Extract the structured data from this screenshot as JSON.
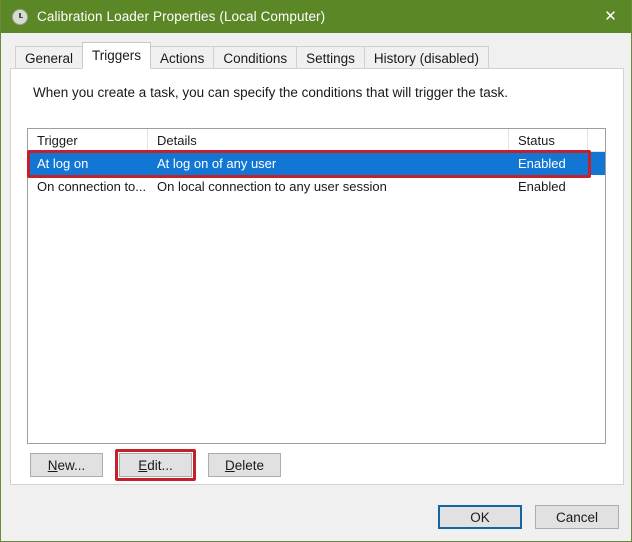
{
  "window": {
    "title": "Calibration Loader Properties (Local Computer)",
    "icon": "clock-icon",
    "close_label": "✕",
    "titlebar_color": "#5c8727",
    "accent_color": "#1277d4",
    "annotation_color": "#c4202a"
  },
  "tabs": [
    {
      "label": "General",
      "active": false
    },
    {
      "label": "Triggers",
      "active": true
    },
    {
      "label": "Actions",
      "active": false
    },
    {
      "label": "Conditions",
      "active": false
    },
    {
      "label": "Settings",
      "active": false
    },
    {
      "label": "History (disabled)",
      "active": false
    }
  ],
  "panel": {
    "description": "When you create a task, you can specify the conditions that will trigger the task."
  },
  "list": {
    "columns": [
      "Trigger",
      "Details",
      "Status"
    ],
    "rows": [
      {
        "trigger": "At log on",
        "details": "At log on of any user",
        "status": "Enabled",
        "selected": true
      },
      {
        "trigger": "On connection to...",
        "details": "On local connection to any user session",
        "status": "Enabled",
        "selected": false
      }
    ]
  },
  "actions": {
    "new": {
      "accel": "N",
      "rest": "ew..."
    },
    "edit": {
      "accel": "E",
      "rest": "dit..."
    },
    "delete": {
      "accel": "D",
      "rest": "elete"
    }
  },
  "footer": {
    "ok": "OK",
    "cancel": "Cancel"
  }
}
